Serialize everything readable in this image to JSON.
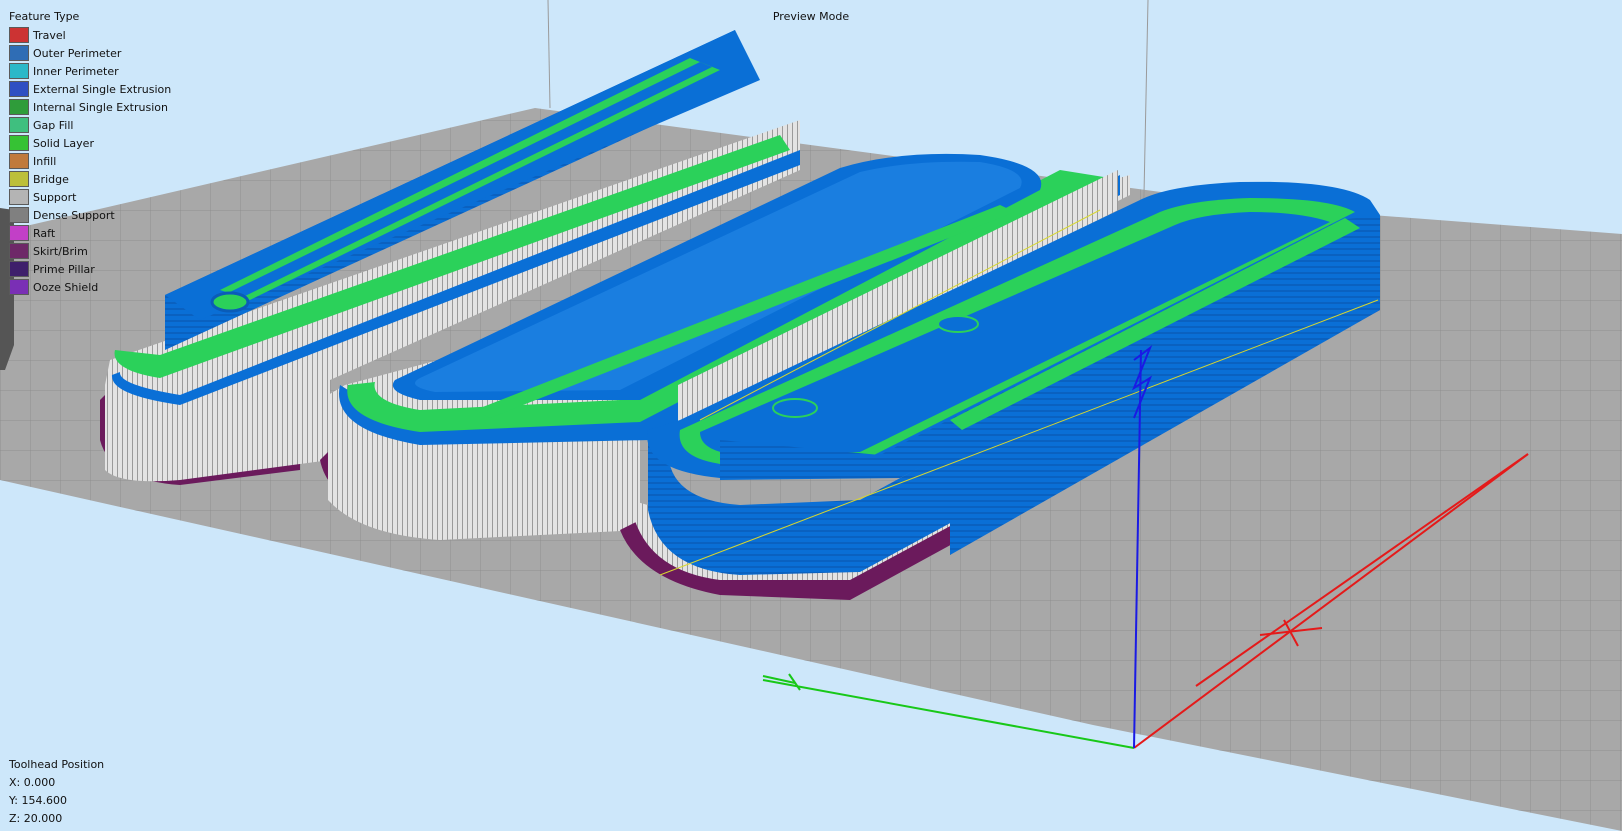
{
  "mode_label": "Preview Mode",
  "legend": {
    "title": "Feature Type",
    "items": [
      {
        "label": "Travel",
        "color": "#cc3333"
      },
      {
        "label": "Outer Perimeter",
        "color": "#2f6db5"
      },
      {
        "label": "Inner Perimeter",
        "color": "#2bb8c8"
      },
      {
        "label": "External Single Extrusion",
        "color": "#2f4fc2"
      },
      {
        "label": "Internal Single Extrusion",
        "color": "#2f9c3a"
      },
      {
        "label": "Gap Fill",
        "color": "#3fbf7f"
      },
      {
        "label": "Solid Layer",
        "color": "#36c234"
      },
      {
        "label": "Infill",
        "color": "#c07a3c"
      },
      {
        "label": "Bridge",
        "color": "#bcbf3a"
      },
      {
        "label": "Support",
        "color": "#b4b4b4"
      },
      {
        "label": "Dense Support",
        "color": "#808080"
      },
      {
        "label": "Raft",
        "color": "#c23fc7"
      },
      {
        "label": "Skirt/Brim",
        "color": "#6e2868"
      },
      {
        "label": "Prime Pillar",
        "color": "#3e1f6b"
      },
      {
        "label": "Ooze Shield",
        "color": "#7a2fb5"
      }
    ]
  },
  "toolhead": {
    "title": "Toolhead Position",
    "x": "X: 0.000",
    "y": "Y: 154.600",
    "z": "Z: 20.000"
  }
}
